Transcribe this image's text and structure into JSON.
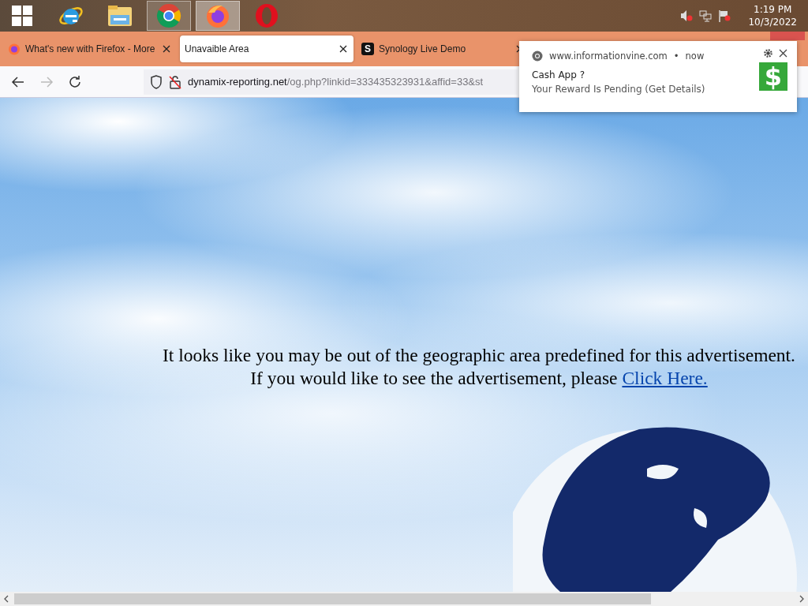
{
  "taskbar": {
    "apps": [
      {
        "kind": "start",
        "running": false,
        "selected": false
      },
      {
        "kind": "ie",
        "running": false,
        "selected": false
      },
      {
        "kind": "explorer",
        "running": false,
        "selected": false
      },
      {
        "kind": "chrome",
        "running": true,
        "selected": false
      },
      {
        "kind": "firefox",
        "running": true,
        "selected": true
      },
      {
        "kind": "opera",
        "running": false,
        "selected": false
      }
    ],
    "tray": {
      "time": "1:19 PM",
      "date": "10/3/2022"
    }
  },
  "tabs": [
    {
      "kind": "firefox",
      "label": "What's new with Firefox - More",
      "selected": false
    },
    {
      "kind": "blank",
      "label": "Unavaible Area",
      "selected": true
    },
    {
      "kind": "letter",
      "icon_letter": "S",
      "label": "Synology Live Demo",
      "selected": false
    }
  ],
  "address_bar": {
    "url_host": "dynamix-reporting.net",
    "url_path": "/og.php?linkid=333435323931&affid=33&st"
  },
  "page": {
    "line_1": "It looks like you may be out of the geographic area predefined for this advertisement.",
    "line_2": "If you would like to see the advertisement, please ",
    "link": "Click Here."
  },
  "notification": {
    "site": "www.informationvine.com",
    "separator": "•",
    "time": "now",
    "title": "Cash App ?",
    "body": "Your Reward Is Pending (Get Details)",
    "image_glyph": "$"
  }
}
